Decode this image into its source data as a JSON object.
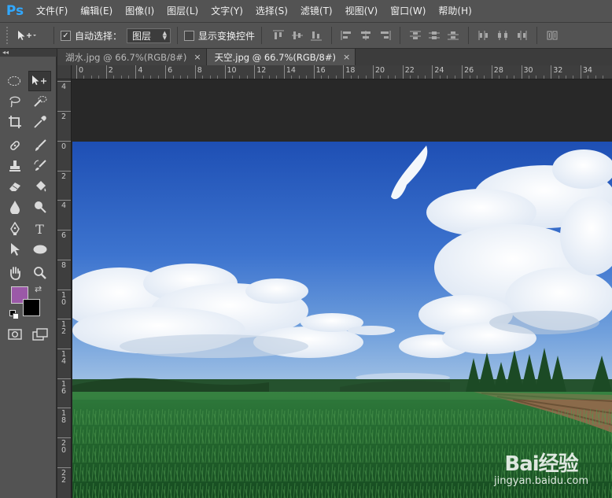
{
  "app": {
    "logo": "Ps"
  },
  "menu": [
    "文件(F)",
    "编辑(E)",
    "图像(I)",
    "图层(L)",
    "文字(Y)",
    "选择(S)",
    "滤镜(T)",
    "视图(V)",
    "窗口(W)",
    "帮助(H)"
  ],
  "options": {
    "auto_select_label": "自动选择：",
    "auto_select_checked": true,
    "auto_select_value": "图层",
    "show_transform_label": "显示变换控件",
    "show_transform_checked": false
  },
  "tabs": [
    {
      "label": "湖水.jpg @ 66.7%(RGB/8#)",
      "active": false,
      "close": "×"
    },
    {
      "label": "天空.jpg @ 66.7%(RGB/8#)",
      "active": true,
      "close": "×"
    }
  ],
  "hruler": [
    "0",
    "2",
    "4",
    "6",
    "8",
    "10",
    "12",
    "14",
    "16",
    "18",
    "20",
    "22",
    "24",
    "26",
    "28",
    "30",
    "32",
    "34"
  ],
  "vruler_top": [
    "4",
    "2"
  ],
  "vruler": [
    "0",
    "2",
    "4",
    "6",
    "8",
    "10",
    "12",
    "14",
    "16",
    "18",
    "20",
    "22"
  ],
  "colors": {
    "foreground": "#9b59a8",
    "background": "#000000",
    "accent": "#31a8ff"
  },
  "tools": [
    "marquee-icon",
    "move-icon",
    "lasso-icon",
    "quick-select-icon",
    "crop-icon",
    "eyedropper-icon",
    "healing-icon",
    "brush-icon",
    "stamp-icon",
    "history-brush-icon",
    "eraser-icon",
    "paint-bucket-icon",
    "blur-icon",
    "dodge-icon",
    "pen-icon",
    "type-icon",
    "path-select-icon",
    "ellipse-icon",
    "hand-icon",
    "zoom-icon",
    "quick-mask-icon",
    "screen-mode-icon"
  ],
  "watermark": {
    "logo": "Bai经验",
    "url": "jingyan.baidu.com"
  }
}
